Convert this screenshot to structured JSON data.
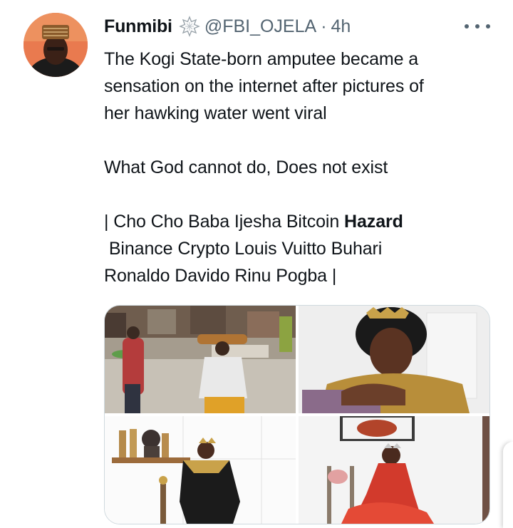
{
  "tweet": {
    "display_name": "Funmibi",
    "handle": "@FBI_OJELA",
    "separator": "·",
    "time": "4h",
    "verified_icon": "sparkle-badge-icon",
    "more_icon": "more-horizontal-icon",
    "text": {
      "line1": "The Kogi State-born amputee became a",
      "line2": "sensation on the internet after pictures of",
      "line3": "her hawking water went viral",
      "line4": "What God cannot do, Does not exist",
      "line5_prefix": "| Cho Cho Baba Ijesha Bitcoin ",
      "line5_bold": "Hazard",
      "line6": " Binance Crypto Louis Vuitto Buhari",
      "line7": "Ronaldo Davido Rinu Pogba |"
    }
  },
  "colors": {
    "text_primary": "#0f1419",
    "text_secondary": "#536471",
    "media_border": "#cfd9de"
  }
}
